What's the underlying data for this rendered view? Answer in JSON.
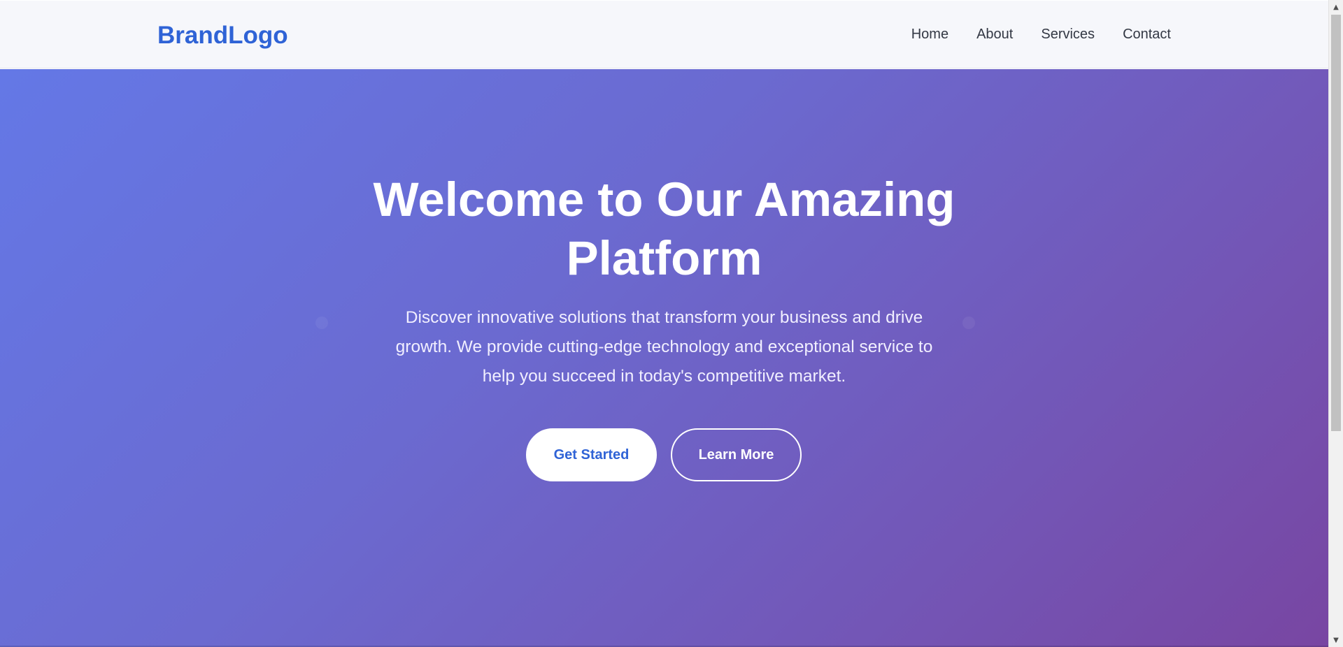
{
  "header": {
    "brand": "BrandLogo",
    "nav": [
      "Home",
      "About",
      "Services",
      "Contact"
    ]
  },
  "hero": {
    "title": "Welcome to Our Amazing Platform",
    "subtitle": "Discover innovative solutions that transform your business and drive growth. We provide cutting-edge technology and exceptional service to help you succeed in today's competitive market.",
    "primary_button": "Get Started",
    "secondary_button": "Learn More"
  },
  "colors": {
    "brand": "#2f63d6",
    "hero_gradient_start": "#6478e6",
    "hero_gradient_end": "#7846a2",
    "navbar_bg": "#f6f7fb"
  },
  "icons": {
    "scroll_up": "triangle-up-icon",
    "scroll_down": "triangle-down-icon"
  }
}
